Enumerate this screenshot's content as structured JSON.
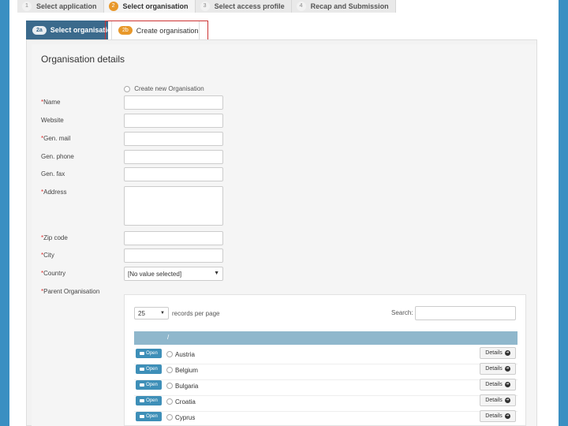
{
  "wizard": {
    "steps": [
      {
        "num": "1",
        "label": "Select application"
      },
      {
        "num": "2",
        "label": "Select organisation"
      },
      {
        "num": "3",
        "label": "Select access profile"
      },
      {
        "num": "4",
        "label": "Recap and Submission"
      }
    ]
  },
  "subtabs": [
    {
      "badge": "2a",
      "label": "Select organisation"
    },
    {
      "badge": "2b",
      "label": "Create organisation"
    }
  ],
  "form": {
    "title": "Organisation details",
    "new_org_label": "Create new Organisation",
    "fields": {
      "name": "Name",
      "website": "Website",
      "email": "Gen. mail",
      "phone": "Gen. phone",
      "fax": "Gen. fax",
      "address": "Address",
      "zip": "Zip code",
      "city": "City",
      "country": "Country",
      "parent": "Parent Organisation"
    },
    "required_mark": "*",
    "country_value": "[No value selected]"
  },
  "table": {
    "page_length": "25",
    "records_label": "records per page",
    "search_label": "Search:",
    "header_col": "/",
    "open_label": "Open",
    "details_label": "Details",
    "rows": [
      "Austria",
      "Belgium",
      "Bulgaria",
      "Croatia",
      "Cyprus"
    ]
  }
}
